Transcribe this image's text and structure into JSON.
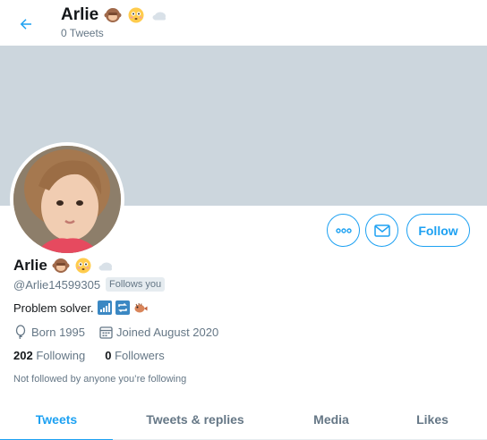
{
  "header": {
    "name": "Arlie",
    "tweet_count": "0 Tweets"
  },
  "profile": {
    "name": "Arlie",
    "handle": "@Arlie14599305",
    "follows_you": "Follows you",
    "bio": "Problem solver.",
    "born": "Born 1995",
    "joined": "Joined August 2020",
    "following_count": "202",
    "following_label": "Following",
    "followers_count": "0",
    "followers_label": "Followers",
    "not_followed": "Not followed by anyone you’re following"
  },
  "actions": {
    "follow_label": "Follow"
  },
  "tabs": [
    {
      "label": "Tweets",
      "active": true
    },
    {
      "label": "Tweets & replies",
      "active": false
    },
    {
      "label": "Media",
      "active": false
    },
    {
      "label": "Likes",
      "active": false
    }
  ],
  "icons": {
    "back": "back-arrow-icon",
    "more": "more-icon",
    "message": "envelope-icon",
    "born": "balloon-icon",
    "joined": "calendar-icon",
    "name_emojis": [
      "see-no-evil-monkey-icon",
      "flushed-face-icon",
      "cloud-icon"
    ],
    "bio_emojis": [
      "signal-bars-icon",
      "repeat-button-icon",
      "blowfish-icon"
    ]
  },
  "colors": {
    "accent": "#1da1f2",
    "banner": "#ccd6dd",
    "muted": "#657786"
  }
}
